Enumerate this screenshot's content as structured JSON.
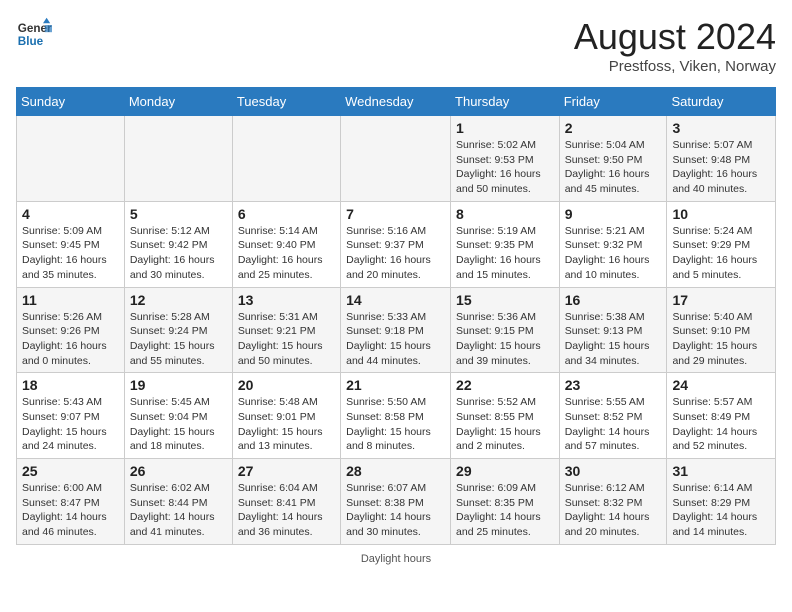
{
  "header": {
    "logo_line1": "General",
    "logo_line2": "Blue",
    "month_title": "August 2024",
    "location": "Prestfoss, Viken, Norway"
  },
  "weekdays": [
    "Sunday",
    "Monday",
    "Tuesday",
    "Wednesday",
    "Thursday",
    "Friday",
    "Saturday"
  ],
  "footer": {
    "label": "Daylight hours"
  },
  "weeks": [
    [
      {
        "day": "",
        "sunrise": "",
        "sunset": "",
        "daylight": ""
      },
      {
        "day": "",
        "sunrise": "",
        "sunset": "",
        "daylight": ""
      },
      {
        "day": "",
        "sunrise": "",
        "sunset": "",
        "daylight": ""
      },
      {
        "day": "",
        "sunrise": "",
        "sunset": "",
        "daylight": ""
      },
      {
        "day": "1",
        "sunrise": "Sunrise: 5:02 AM",
        "sunset": "Sunset: 9:53 PM",
        "daylight": "Daylight: 16 hours and 50 minutes."
      },
      {
        "day": "2",
        "sunrise": "Sunrise: 5:04 AM",
        "sunset": "Sunset: 9:50 PM",
        "daylight": "Daylight: 16 hours and 45 minutes."
      },
      {
        "day": "3",
        "sunrise": "Sunrise: 5:07 AM",
        "sunset": "Sunset: 9:48 PM",
        "daylight": "Daylight: 16 hours and 40 minutes."
      }
    ],
    [
      {
        "day": "4",
        "sunrise": "Sunrise: 5:09 AM",
        "sunset": "Sunset: 9:45 PM",
        "daylight": "Daylight: 16 hours and 35 minutes."
      },
      {
        "day": "5",
        "sunrise": "Sunrise: 5:12 AM",
        "sunset": "Sunset: 9:42 PM",
        "daylight": "Daylight: 16 hours and 30 minutes."
      },
      {
        "day": "6",
        "sunrise": "Sunrise: 5:14 AM",
        "sunset": "Sunset: 9:40 PM",
        "daylight": "Daylight: 16 hours and 25 minutes."
      },
      {
        "day": "7",
        "sunrise": "Sunrise: 5:16 AM",
        "sunset": "Sunset: 9:37 PM",
        "daylight": "Daylight: 16 hours and 20 minutes."
      },
      {
        "day": "8",
        "sunrise": "Sunrise: 5:19 AM",
        "sunset": "Sunset: 9:35 PM",
        "daylight": "Daylight: 16 hours and 15 minutes."
      },
      {
        "day": "9",
        "sunrise": "Sunrise: 5:21 AM",
        "sunset": "Sunset: 9:32 PM",
        "daylight": "Daylight: 16 hours and 10 minutes."
      },
      {
        "day": "10",
        "sunrise": "Sunrise: 5:24 AM",
        "sunset": "Sunset: 9:29 PM",
        "daylight": "Daylight: 16 hours and 5 minutes."
      }
    ],
    [
      {
        "day": "11",
        "sunrise": "Sunrise: 5:26 AM",
        "sunset": "Sunset: 9:26 PM",
        "daylight": "Daylight: 16 hours and 0 minutes."
      },
      {
        "day": "12",
        "sunrise": "Sunrise: 5:28 AM",
        "sunset": "Sunset: 9:24 PM",
        "daylight": "Daylight: 15 hours and 55 minutes."
      },
      {
        "day": "13",
        "sunrise": "Sunrise: 5:31 AM",
        "sunset": "Sunset: 9:21 PM",
        "daylight": "Daylight: 15 hours and 50 minutes."
      },
      {
        "day": "14",
        "sunrise": "Sunrise: 5:33 AM",
        "sunset": "Sunset: 9:18 PM",
        "daylight": "Daylight: 15 hours and 44 minutes."
      },
      {
        "day": "15",
        "sunrise": "Sunrise: 5:36 AM",
        "sunset": "Sunset: 9:15 PM",
        "daylight": "Daylight: 15 hours and 39 minutes."
      },
      {
        "day": "16",
        "sunrise": "Sunrise: 5:38 AM",
        "sunset": "Sunset: 9:13 PM",
        "daylight": "Daylight: 15 hours and 34 minutes."
      },
      {
        "day": "17",
        "sunrise": "Sunrise: 5:40 AM",
        "sunset": "Sunset: 9:10 PM",
        "daylight": "Daylight: 15 hours and 29 minutes."
      }
    ],
    [
      {
        "day": "18",
        "sunrise": "Sunrise: 5:43 AM",
        "sunset": "Sunset: 9:07 PM",
        "daylight": "Daylight: 15 hours and 24 minutes."
      },
      {
        "day": "19",
        "sunrise": "Sunrise: 5:45 AM",
        "sunset": "Sunset: 9:04 PM",
        "daylight": "Daylight: 15 hours and 18 minutes."
      },
      {
        "day": "20",
        "sunrise": "Sunrise: 5:48 AM",
        "sunset": "Sunset: 9:01 PM",
        "daylight": "Daylight: 15 hours and 13 minutes."
      },
      {
        "day": "21",
        "sunrise": "Sunrise: 5:50 AM",
        "sunset": "Sunset: 8:58 PM",
        "daylight": "Daylight: 15 hours and 8 minutes."
      },
      {
        "day": "22",
        "sunrise": "Sunrise: 5:52 AM",
        "sunset": "Sunset: 8:55 PM",
        "daylight": "Daylight: 15 hours and 2 minutes."
      },
      {
        "day": "23",
        "sunrise": "Sunrise: 5:55 AM",
        "sunset": "Sunset: 8:52 PM",
        "daylight": "Daylight: 14 hours and 57 minutes."
      },
      {
        "day": "24",
        "sunrise": "Sunrise: 5:57 AM",
        "sunset": "Sunset: 8:49 PM",
        "daylight": "Daylight: 14 hours and 52 minutes."
      }
    ],
    [
      {
        "day": "25",
        "sunrise": "Sunrise: 6:00 AM",
        "sunset": "Sunset: 8:47 PM",
        "daylight": "Daylight: 14 hours and 46 minutes."
      },
      {
        "day": "26",
        "sunrise": "Sunrise: 6:02 AM",
        "sunset": "Sunset: 8:44 PM",
        "daylight": "Daylight: 14 hours and 41 minutes."
      },
      {
        "day": "27",
        "sunrise": "Sunrise: 6:04 AM",
        "sunset": "Sunset: 8:41 PM",
        "daylight": "Daylight: 14 hours and 36 minutes."
      },
      {
        "day": "28",
        "sunrise": "Sunrise: 6:07 AM",
        "sunset": "Sunset: 8:38 PM",
        "daylight": "Daylight: 14 hours and 30 minutes."
      },
      {
        "day": "29",
        "sunrise": "Sunrise: 6:09 AM",
        "sunset": "Sunset: 8:35 PM",
        "daylight": "Daylight: 14 hours and 25 minutes."
      },
      {
        "day": "30",
        "sunrise": "Sunrise: 6:12 AM",
        "sunset": "Sunset: 8:32 PM",
        "daylight": "Daylight: 14 hours and 20 minutes."
      },
      {
        "day": "31",
        "sunrise": "Sunrise: 6:14 AM",
        "sunset": "Sunset: 8:29 PM",
        "daylight": "Daylight: 14 hours and 14 minutes."
      }
    ]
  ]
}
